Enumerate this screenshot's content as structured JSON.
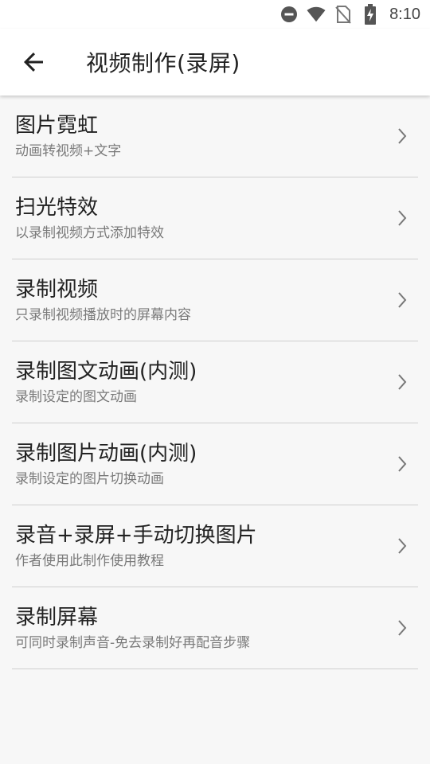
{
  "status_bar": {
    "time": "8:10",
    "icons": [
      "do-not-disturb-icon",
      "wifi-icon",
      "no-sim-icon",
      "battery-charging-icon"
    ]
  },
  "app_bar": {
    "title": "视频制作(录屏)",
    "back_icon": "arrow-back-icon"
  },
  "items": [
    {
      "title": "图片霓虹",
      "subtitle": "动画转视频+文字"
    },
    {
      "title": "扫光特效",
      "subtitle": "以录制视频方式添加特效"
    },
    {
      "title": "录制视频",
      "subtitle": "只录制视频播放时的屏幕内容"
    },
    {
      "title": "录制图文动画(内测)",
      "subtitle": "录制设定的图文动画"
    },
    {
      "title": "录制图片动画(内测)",
      "subtitle": "录制设定的图片切换动画"
    },
    {
      "title": "录音+录屏+手动切换图片",
      "subtitle": "作者使用此制作使用教程"
    },
    {
      "title": "录制屏幕",
      "subtitle": "可同时录制声音-免去录制好再配音步骤"
    }
  ]
}
